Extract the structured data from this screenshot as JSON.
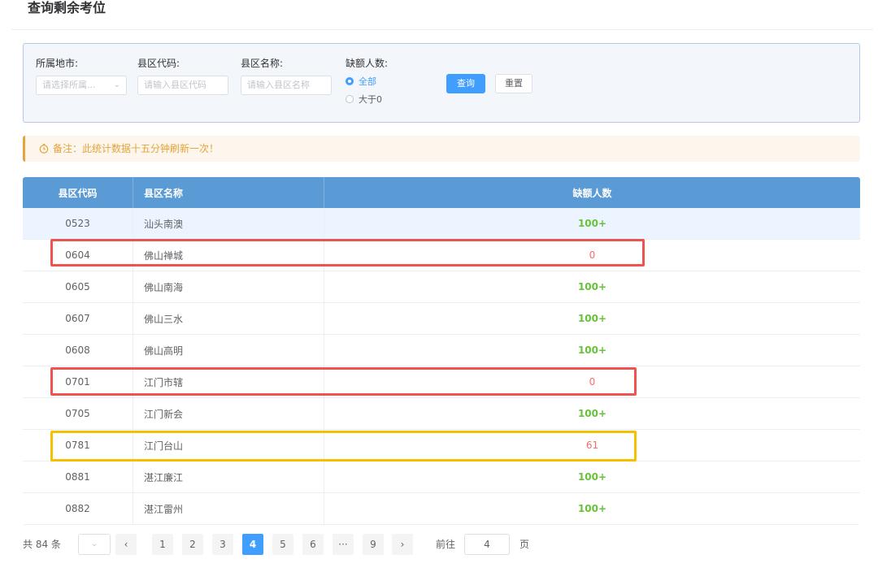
{
  "page": {
    "title": "查询剩余考位"
  },
  "filters": {
    "city": {
      "label": "所属地市:",
      "placeholder": "请选择所属..."
    },
    "county_code": {
      "label": "县区代码:",
      "placeholder": "请输入县区代码"
    },
    "county_name": {
      "label": "县区名称:",
      "placeholder": "请输入县区名称"
    },
    "vacancy": {
      "label": "缺额人数:",
      "options": [
        "全部",
        "大于0"
      ],
      "selected": "全部"
    },
    "query_button": "查询",
    "reset_button": "重置"
  },
  "notice": {
    "text": "备注：此统计数据十五分钟刷新一次！"
  },
  "table": {
    "headers": [
      "县区代码",
      "县区名称",
      "缺额人数"
    ],
    "rows": [
      {
        "code": "0523",
        "name": "汕头南澳",
        "vacancy": "100+"
      },
      {
        "code": "0604",
        "name": "佛山禅城",
        "vacancy": "0"
      },
      {
        "code": "0605",
        "name": "佛山南海",
        "vacancy": "100+"
      },
      {
        "code": "0607",
        "name": "佛山三水",
        "vacancy": "100+"
      },
      {
        "code": "0608",
        "name": "佛山高明",
        "vacancy": "100+"
      },
      {
        "code": "0701",
        "name": "江门市辖",
        "vacancy": "0"
      },
      {
        "code": "0705",
        "name": "江门新会",
        "vacancy": "100+"
      },
      {
        "code": "0781",
        "name": "江门台山",
        "vacancy": "61"
      },
      {
        "code": "0881",
        "name": "湛江廉江",
        "vacancy": "100+"
      },
      {
        "code": "0882",
        "name": "湛江雷州",
        "vacancy": "100+"
      }
    ]
  },
  "pagination": {
    "total": "共 84 条",
    "pages": [
      "1",
      "2",
      "3",
      "4",
      "5",
      "6",
      "···",
      "9"
    ],
    "current": "4",
    "goto_label": "前往",
    "goto_value": "4",
    "page_unit": "页"
  },
  "colors": {
    "primary": "#409eff",
    "ok": "#67c23a",
    "bad": "#f56c6c",
    "warning": "#e6a23c",
    "header": "#5b9bd5",
    "mark_red": "#ef5350",
    "mark_yellow": "#f5c000"
  }
}
